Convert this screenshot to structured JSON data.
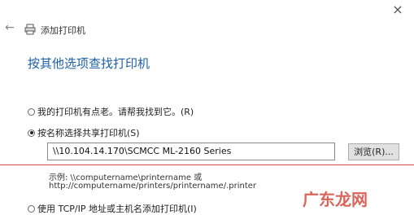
{
  "window": {
    "close_glyph": "×"
  },
  "header": {
    "title": "添加打印机"
  },
  "main": {
    "heading": "按其他选项查找打印机",
    "options": [
      {
        "label": "我的打印机有点老。请帮我找到它。(R)",
        "checked": false
      },
      {
        "label": "按名称选择共享打印机(S)",
        "checked": true
      },
      {
        "label": "使用 TCP/IP 地址或主机名添加打印机(I)",
        "checked": false
      }
    ],
    "printer_name_input": {
      "value": "\\\\10.104.14.170\\SCMCC ML-2160 Series"
    },
    "browse_button": {
      "label": "浏览(R)..."
    },
    "example_line1": "示例: \\\\computername\\printername 或",
    "example_line2": "http://computername/printers/printername/.printer"
  },
  "watermark": {
    "text": "广东龙网"
  }
}
